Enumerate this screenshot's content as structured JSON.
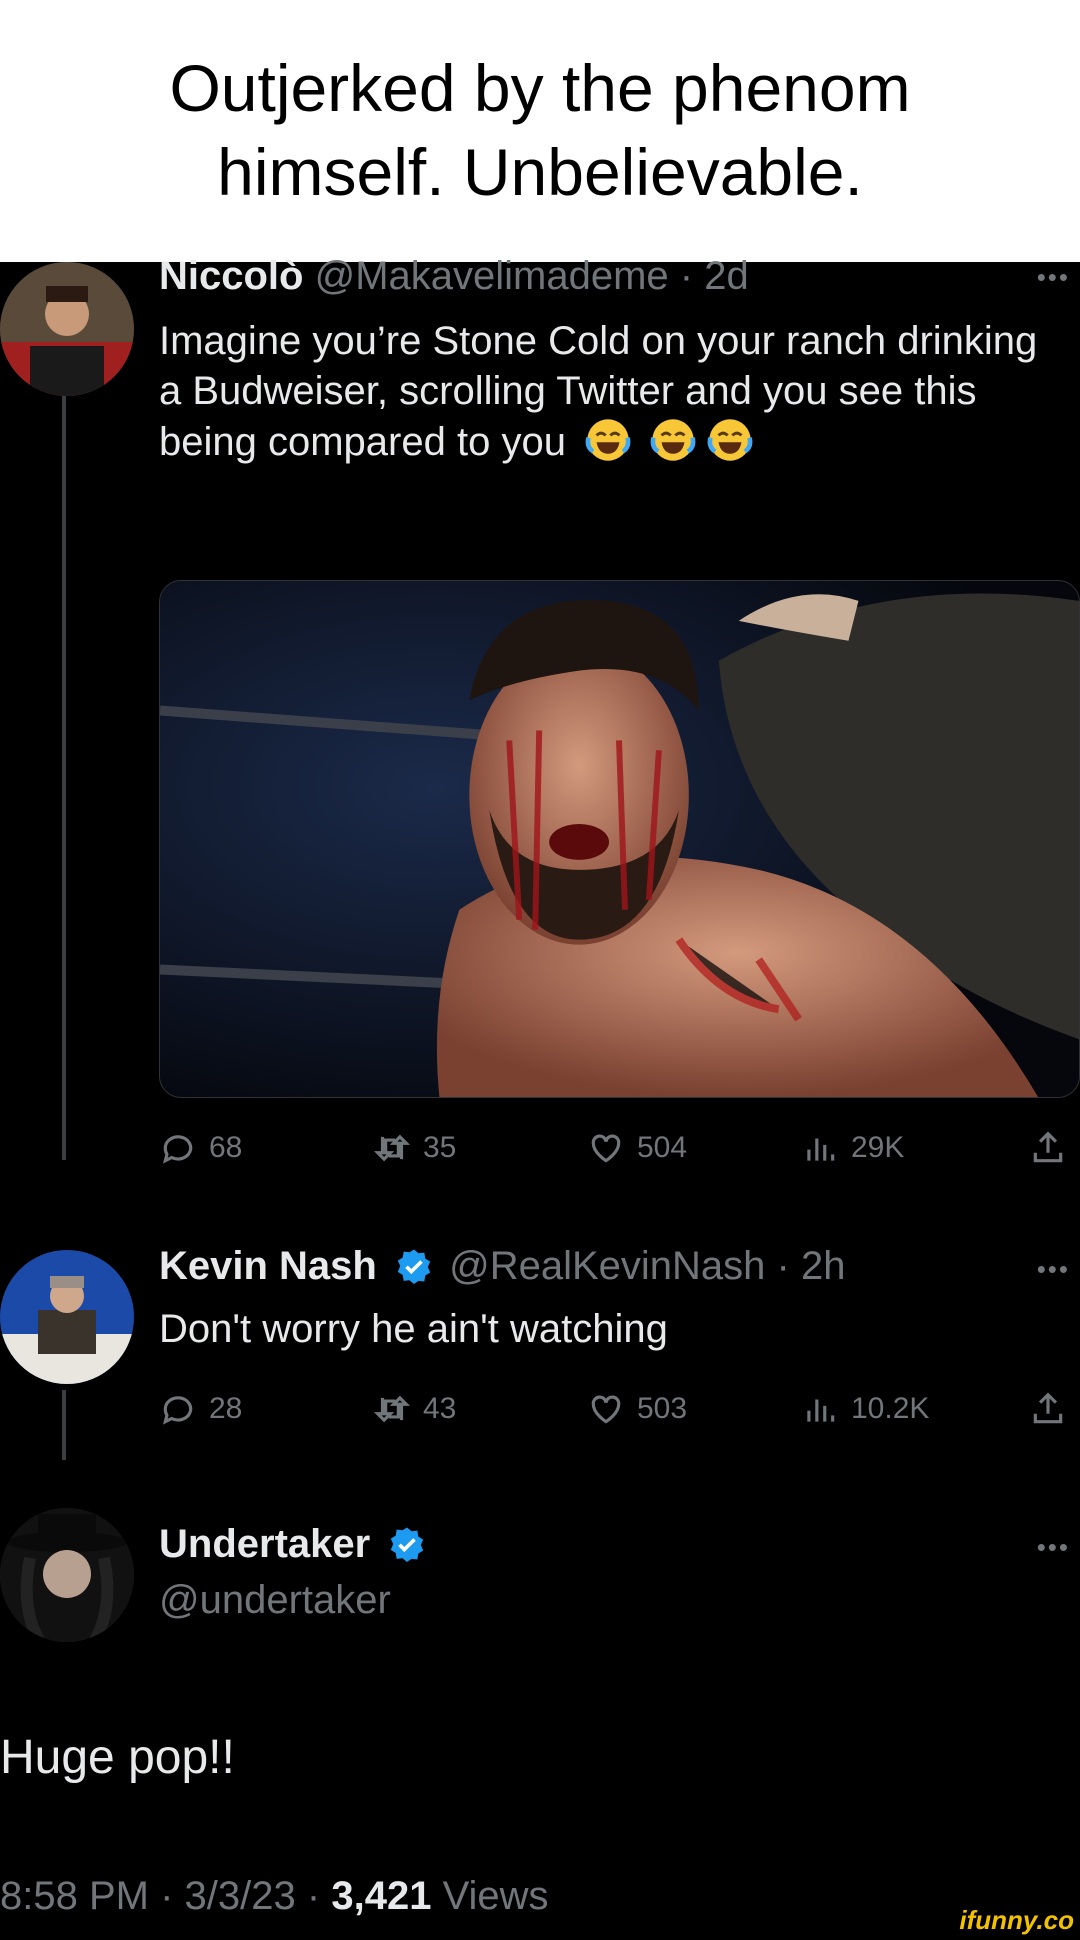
{
  "caption": {
    "text": "Outjerked by the phenom himself. Unbelievable."
  },
  "tweets": [
    {
      "name": "Niccolò",
      "handle": "@Makavelimademe",
      "time": "2d",
      "text": "Imagine you’re Stone Cold on your ranch drinking a Budweiser, scrolling Twitter and you see this being compared to you",
      "emoji": "face-with-tears-of-joy",
      "stats": {
        "replies": "68",
        "retweets": "35",
        "likes": "504",
        "views": "29K"
      }
    },
    {
      "name": "Kevin Nash",
      "handle": "@RealKevinNash",
      "time": "2h",
      "text": "Don't worry he ain't watching",
      "verified": true,
      "stats": {
        "replies": "28",
        "retweets": "43",
        "likes": "503",
        "views": "10.2K"
      }
    },
    {
      "name": "Undertaker",
      "handle": "@undertaker",
      "verified": true,
      "text": "Huge pop!!",
      "footer": {
        "time": "8:58 PM",
        "date": "3/3/23",
        "views_count": "3,421",
        "views_label": "Views"
      }
    }
  ],
  "more_label": "•••",
  "separator": "·",
  "watermark": "ifunny.co",
  "colors": {
    "background": "#000000",
    "text": "#e7e9ea",
    "secondary": "#71767b",
    "verified": "#1d9bf0"
  }
}
